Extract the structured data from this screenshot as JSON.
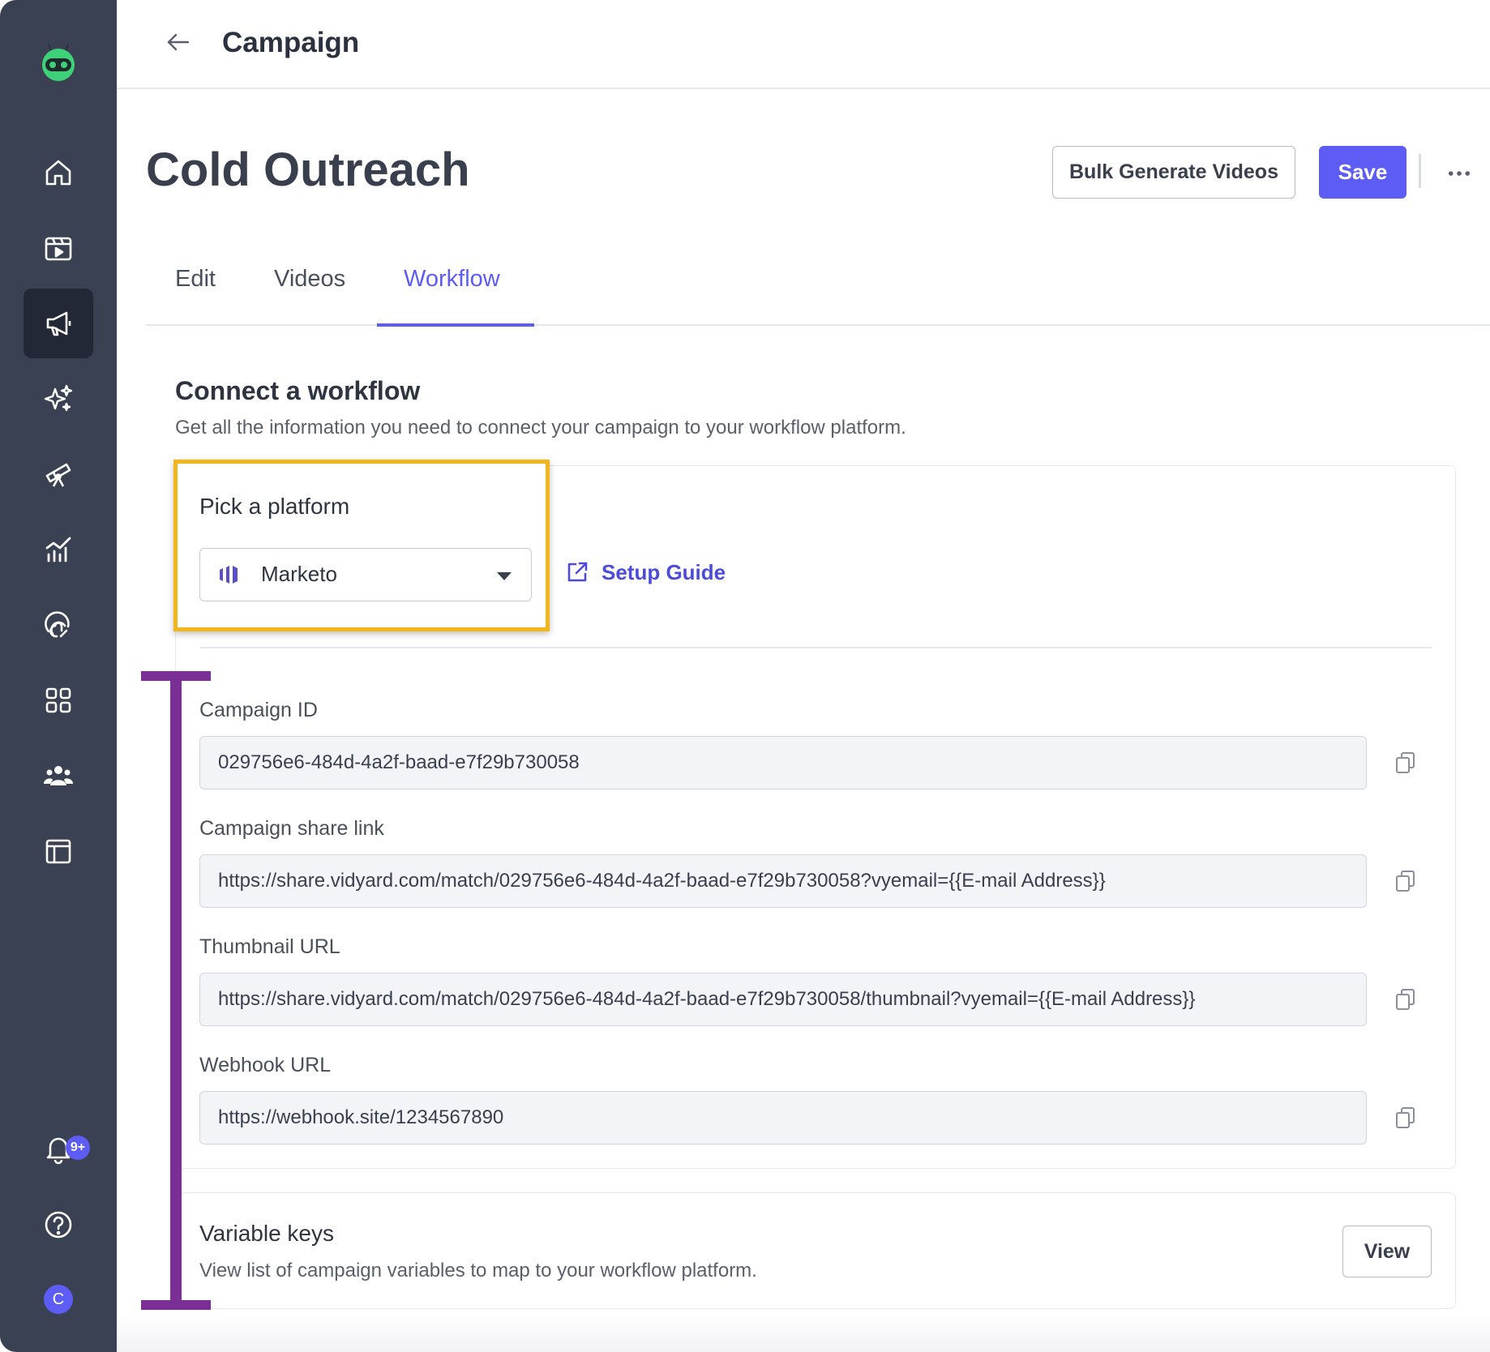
{
  "colors": {
    "sidebar": "#3a4152",
    "sidebar_active": "#232836",
    "accent": "#5d5cf5",
    "highlight_box": "#f2b51c",
    "annotation_bracket": "#7a2f94",
    "logo_green": "#3fd07a"
  },
  "sidebar": {
    "items": [
      {
        "icon": "home-icon"
      },
      {
        "icon": "video-library-icon"
      },
      {
        "icon": "megaphone-icon",
        "active": true
      },
      {
        "icon": "sparkles-icon"
      },
      {
        "icon": "telescope-icon"
      },
      {
        "icon": "analytics-icon"
      },
      {
        "icon": "fingerprint-icon"
      },
      {
        "icon": "apps-grid-icon"
      },
      {
        "icon": "team-icon"
      },
      {
        "icon": "layout-icon"
      }
    ],
    "notifications_badge": "9+",
    "help_icon": "help-icon",
    "avatar_initial": "C"
  },
  "header": {
    "title": "Campaign"
  },
  "page": {
    "title": "Cold Outreach",
    "bulk_button": "Bulk Generate Videos",
    "save_button": "Save"
  },
  "tabs": [
    {
      "label": "Edit",
      "active": false
    },
    {
      "label": "Videos",
      "active": false
    },
    {
      "label": "Workflow",
      "active": true
    }
  ],
  "workflow": {
    "title": "Connect a workflow",
    "subtitle": "Get all the information you need to connect your campaign to your workflow platform.",
    "platform_label": "Pick a platform",
    "platform_value": "Marketo",
    "setup_guide": "Setup Guide",
    "fields": [
      {
        "label": "Campaign ID",
        "value": "029756e6-484d-4a2f-baad-e7f29b730058"
      },
      {
        "label": "Campaign share link",
        "value": "https://share.vidyard.com/match/029756e6-484d-4a2f-baad-e7f29b730058?vyemail={{E-mail Address}}"
      },
      {
        "label": "Thumbnail URL",
        "value": "https://share.vidyard.com/match/029756e6-484d-4a2f-baad-e7f29b730058/thumbnail?vyemail={{E-mail Address}}"
      },
      {
        "label": "Webhook URL",
        "value": "https://webhook.site/1234567890"
      }
    ]
  },
  "variable_keys": {
    "title": "Variable keys",
    "subtitle": "View list of campaign variables to map to your workflow platform.",
    "view_button": "View"
  }
}
